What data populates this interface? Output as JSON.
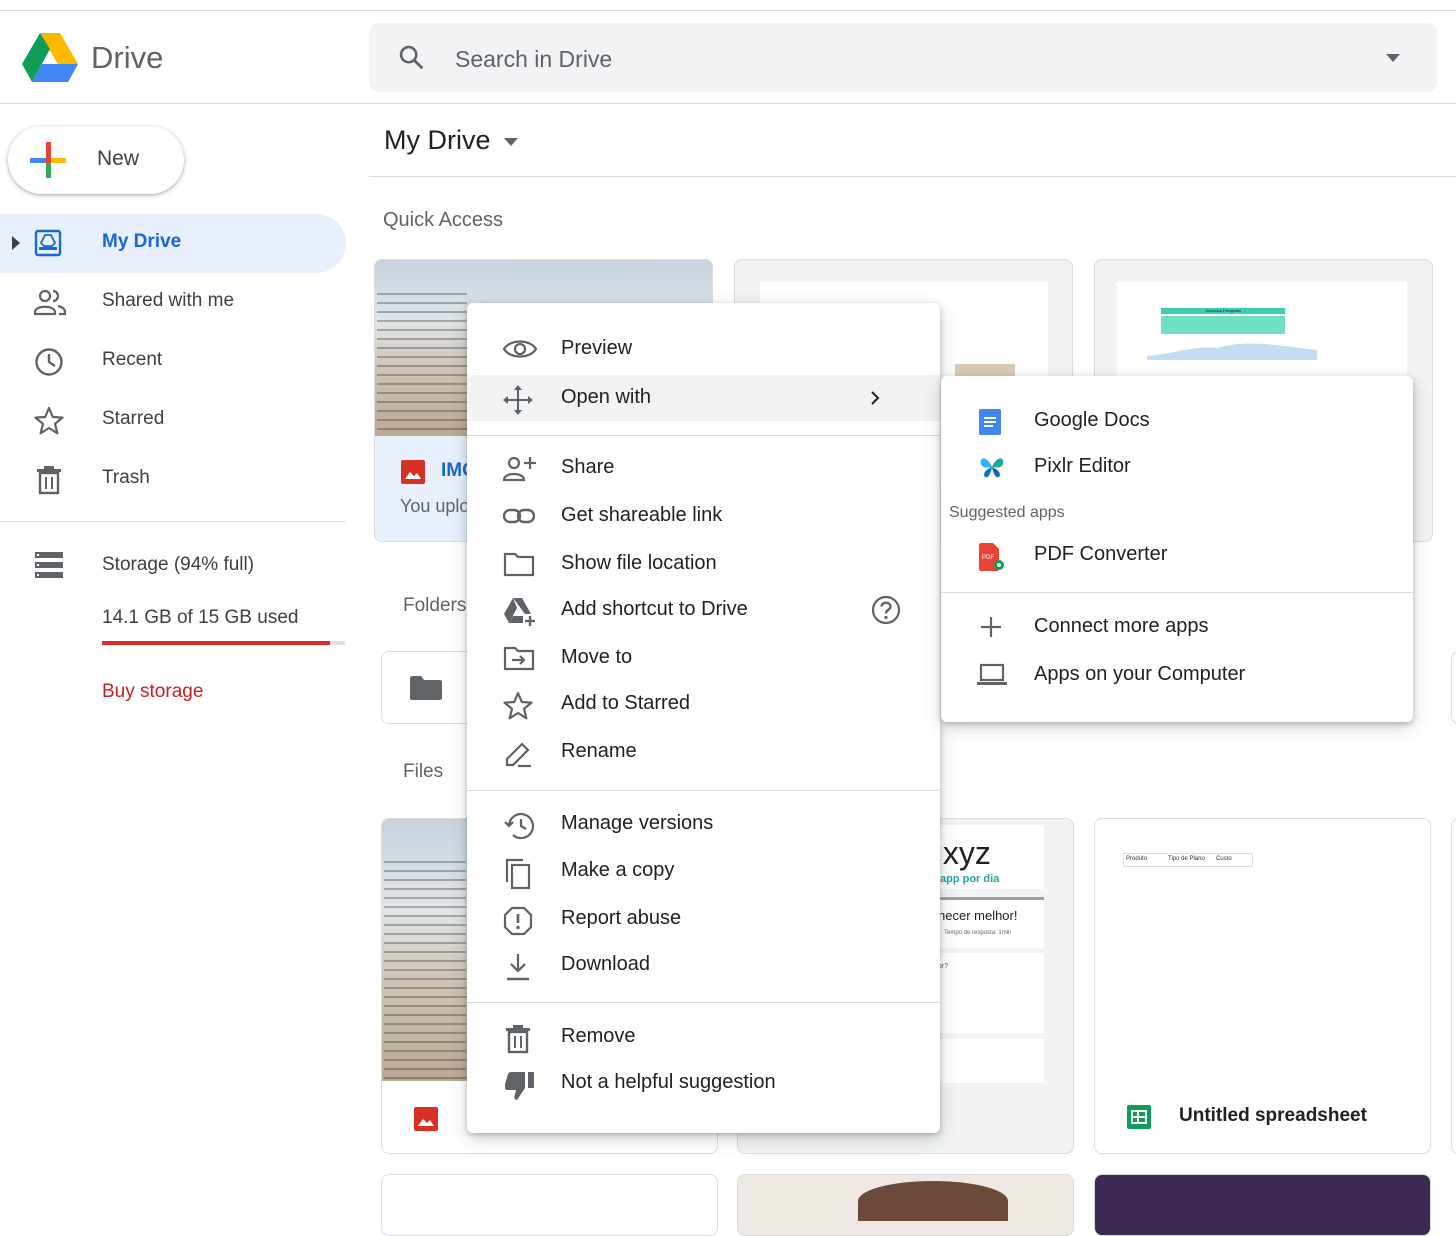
{
  "app": {
    "name": "Drive"
  },
  "search": {
    "placeholder": "Search in Drive"
  },
  "sidebar": {
    "new_label": "New",
    "items": [
      {
        "label": "My Drive",
        "icon": "my-drive-icon",
        "active": true
      },
      {
        "label": "Shared with me",
        "icon": "people-icon"
      },
      {
        "label": "Recent",
        "icon": "clock-icon"
      },
      {
        "label": "Starred",
        "icon": "star-icon"
      },
      {
        "label": "Trash",
        "icon": "trash-icon"
      }
    ],
    "storage": {
      "label": "Storage (94% full)",
      "used": "14.1 GB of 15 GB used",
      "fraction": 0.94,
      "bar_color": "#d93025"
    },
    "buy_label": "Buy storage"
  },
  "main": {
    "title": "My Drive",
    "quick_access_label": "Quick Access",
    "quick_access_card": {
      "name": "IMG",
      "subtitle": "You uplo"
    },
    "folders_label": "Folders",
    "files_label": "Files",
    "file_cards": [
      {
        "name": "Untitled spreadsheet",
        "icon": "sheets-icon"
      }
    ],
    "form_preview": {
      "heading": ".xyz",
      "subheading": "app por dia",
      "question": "hecer melhor!",
      "meta": "Tempo de resposta: 1min",
      "q2": "or?"
    },
    "sheet_preview": {
      "headers": [
        "Produto",
        "Tipo de Plano",
        "Custo"
      ]
    },
    "chart_preview": {
      "title": "Nascidos Fotografia"
    }
  },
  "context_menu": {
    "groups": [
      [
        {
          "label": "Preview",
          "icon": "eye-icon"
        },
        {
          "label": "Open with",
          "icon": "move-arrows-icon",
          "submenu": true,
          "highlighted": true
        }
      ],
      [
        {
          "label": "Share",
          "icon": "person-add-icon"
        },
        {
          "label": "Get shareable link",
          "icon": "link-icon"
        },
        {
          "label": "Show file location",
          "icon": "folder-icon"
        },
        {
          "label": "Add shortcut to Drive",
          "icon": "drive-shortcut-icon",
          "help": true
        },
        {
          "label": "Move to",
          "icon": "move-to-icon"
        },
        {
          "label": "Add to Starred",
          "icon": "star-icon"
        },
        {
          "label": "Rename",
          "icon": "pencil-icon"
        }
      ],
      [
        {
          "label": "Manage versions",
          "icon": "history-icon"
        },
        {
          "label": "Make a copy",
          "icon": "copy-icon"
        },
        {
          "label": "Report abuse",
          "icon": "alert-icon"
        },
        {
          "label": "Download",
          "icon": "download-icon"
        }
      ],
      [
        {
          "label": "Remove",
          "icon": "trash-icon"
        },
        {
          "label": "Not a helpful suggestion",
          "icon": "thumbs-down-icon"
        }
      ]
    ]
  },
  "open_with_menu": {
    "apps": [
      {
        "label": "Google Docs",
        "icon": "docs-icon"
      },
      {
        "label": "Pixlr Editor",
        "icon": "pixlr-butterfly-icon"
      }
    ],
    "suggested_label": "Suggested apps",
    "suggested": [
      {
        "label": "PDF Converter",
        "icon": "pdf-icon"
      }
    ],
    "footer": [
      {
        "label": "Connect more apps",
        "icon": "plus-icon"
      },
      {
        "label": "Apps on your Computer",
        "icon": "laptop-icon"
      }
    ]
  },
  "colors": {
    "accent": "#1967d2",
    "active_bg": "#e8f0fe",
    "danger": "#c5221f"
  }
}
